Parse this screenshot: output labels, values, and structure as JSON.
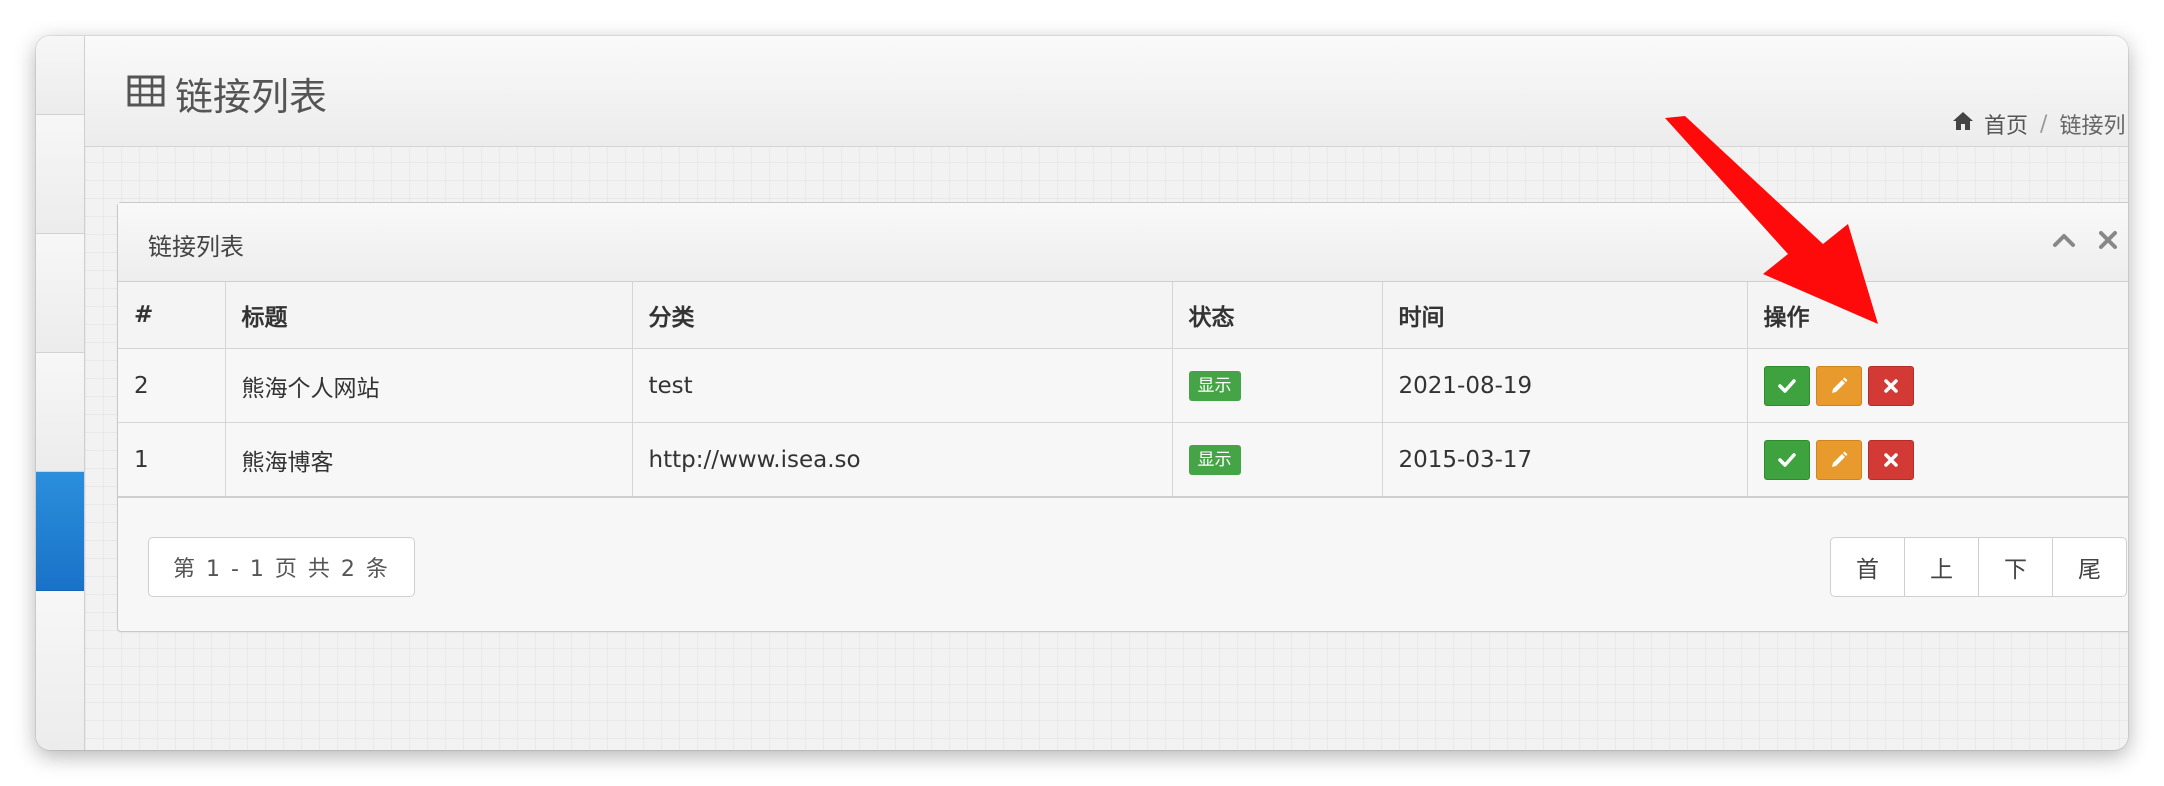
{
  "page": {
    "title": "链接列表",
    "breadcrumb": {
      "home": "首页",
      "separator": "/",
      "current": "链接列"
    }
  },
  "panel": {
    "title": "链接列表",
    "collapse_icon": "chevron-up-icon",
    "close_icon": "close-icon"
  },
  "table": {
    "headers": [
      "#",
      "标题",
      "分类",
      "状态",
      "时间",
      "操作"
    ],
    "rows": [
      {
        "id": "2",
        "title": "熊海个人网站",
        "category": "test",
        "status": "显示",
        "date": "2021-08-19"
      },
      {
        "id": "1",
        "title": "熊海博客",
        "category": "http://www.isea.so",
        "status": "显示",
        "date": "2015-03-17"
      }
    ],
    "action_icons": [
      "check-icon",
      "pencil-icon",
      "close-icon"
    ]
  },
  "pagination": {
    "info": "第 1 - 1 页 共 2 条",
    "buttons": [
      "首",
      "上",
      "下",
      "尾"
    ]
  },
  "colors": {
    "accent": "#1a72c8",
    "badge": "#45a546",
    "approve": "#3ea33f",
    "edit": "#e89a2c",
    "delete": "#d43a35",
    "arrow": "#ff0000"
  }
}
